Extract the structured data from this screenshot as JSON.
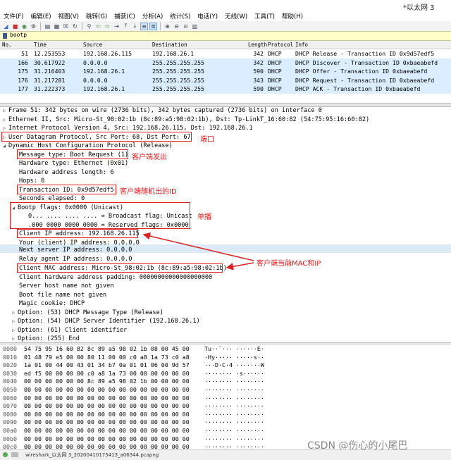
{
  "window": {
    "title": "*以太网 3"
  },
  "menu": [
    "文件(F)",
    "编辑(E)",
    "视图(V)",
    "跳转(G)",
    "捕获(C)",
    "分析(A)",
    "统计(S)",
    "电话(Y)",
    "无线(W)",
    "工具(T)",
    "帮助(H)"
  ],
  "toolbar_icons": [
    "shark-fin-start-icon",
    "stop-icon",
    "restart-icon",
    "options-gear-icon",
    "open-file-icon",
    "save-icon",
    "close-file-icon",
    "reload-icon",
    "find-icon",
    "back-arrow-icon",
    "forward-arrow-icon",
    "goto-packet-icon",
    "first-packet-icon",
    "last-packet-icon",
    "autoscroll-icon",
    "colorize-icon",
    "zoom-in-icon",
    "zoom-out-icon",
    "zoom-reset-icon",
    "resize-columns-icon"
  ],
  "filter": {
    "value": "bootp"
  },
  "packet_list": {
    "headers": {
      "no": "No.",
      "time": "Time",
      "source": "Source",
      "destination": "Destination",
      "length": "Length",
      "protocol": "Protocol",
      "info": "Info"
    },
    "rows": [
      {
        "no": "51",
        "time": "12.253553",
        "source": "192.168.26.115",
        "destination": "192.168.26.1",
        "length": "342",
        "protocol": "DHCP",
        "info": "DHCP Release  - Transaction ID 0x9d57edf5"
      },
      {
        "no": "166",
        "time": "30.617922",
        "source": "0.0.0.0",
        "destination": "255.255.255.255",
        "length": "342",
        "protocol": "DHCP",
        "info": "DHCP Discover - Transaction ID 0xbaeabefd"
      },
      {
        "no": "175",
        "time": "31.216403",
        "source": "192.168.26.1",
        "destination": "255.255.255.255",
        "length": "590",
        "protocol": "DHCP",
        "info": "DHCP Offer    - Transaction ID 0xbaeabefd"
      },
      {
        "no": "176",
        "time": "31.217281",
        "source": "0.0.0.0",
        "destination": "255.255.255.255",
        "length": "343",
        "protocol": "DHCP",
        "info": "DHCP Request  - Transaction ID 0xbaeabefd"
      },
      {
        "no": "177",
        "time": "31.222373",
        "source": "192.168.26.1",
        "destination": "255.255.255.255",
        "length": "590",
        "protocol": "DHCP",
        "info": "DHCP ACK      - Transaction ID 0xbaeabefd"
      }
    ]
  },
  "details": [
    {
      "text": "Frame 51: 342 bytes on wire (2736 bits), 342 bytes captured (2736 bits) on interface 0",
      "tri": "▷"
    },
    {
      "text": "Ethernet II, Src: Micro-St_98:02:1b (8c:89:a5:98:02:1b), Dst: Tp-LinkT_16:60:82 (54:75:95:16:60:82)",
      "tri": "▷"
    },
    {
      "text": "Internet Protocol Version 4, Src: 192.168.26.115, Dst: 192.168.26.1",
      "tri": "▷"
    },
    {
      "text": "User Datagram Protocol, Src Port: 68, Dst Port: 67",
      "tri": "▷"
    },
    {
      "text": "Dynamic Host Configuration Protocol (Release)",
      "tri": "◢"
    },
    {
      "text": "Message type: Boot Request (1)",
      "tri": ""
    },
    {
      "text": "Hardware type: Ethernet (0x01)",
      "tri": ""
    },
    {
      "text": "Hardware address length: 6",
      "tri": ""
    },
    {
      "text": "Hops: 0",
      "tri": ""
    },
    {
      "text": "Transaction ID: 0x9d57edf5",
      "tri": ""
    },
    {
      "text": "Seconds elapsed: 0",
      "tri": ""
    },
    {
      "text": "Bootp flags: 0x0000 (Unicast)",
      "tri": "◢"
    },
    {
      "text": "0... .... .... .... = Broadcast flag: Unicast",
      "tri": ""
    },
    {
      "text": ".000 0000 0000 0000 = Reserved flags: 0x0000",
      "tri": ""
    },
    {
      "text": "Client IP address: 192.168.26.115",
      "tri": ""
    },
    {
      "text": "Your (client) IP address: 0.0.0.0",
      "tri": ""
    },
    {
      "text": "Next server IP address: 0.0.0.0",
      "tri": ""
    },
    {
      "text": "Relay agent IP address: 0.0.0.0",
      "tri": ""
    },
    {
      "text": "Client MAC address: Micro-St_98:02:1b (8c:89:a5:98:02:1b)",
      "tri": ""
    },
    {
      "text": "Client hardware address padding: 00000000000000000000",
      "tri": ""
    },
    {
      "text": "Server host name not given",
      "tri": ""
    },
    {
      "text": "Boot file name not given",
      "tri": ""
    },
    {
      "text": "Magic cookie: DHCP",
      "tri": ""
    },
    {
      "text": "Option: (53) DHCP Message Type (Release)",
      "tri": "▷"
    },
    {
      "text": "Option: (54) DHCP Server Identifier (192.168.26.1)",
      "tri": "▷"
    },
    {
      "text": "Option: (61) Client identifier",
      "tri": "▷"
    },
    {
      "text": "Option: (255) End",
      "tri": "▷"
    }
  ],
  "annotations": {
    "port": "端口",
    "client_send": "客户端发出",
    "client_random_id": "客户端随机出的ID",
    "unicast": "单播",
    "client_mac_ip": "客户端当前MAC和IP"
  },
  "bytes": [
    {
      "off": "0000",
      "hex": "54 75 95 16 60 82 8c 89  a5 98 02 1b 08 00 45 00",
      "ascii": "Tu··`··· ······E·"
    },
    {
      "off": "0010",
      "hex": "01 48 79 e5 00 00 80 11  00 00 c0 a8 1a 73 c0 a8",
      "ascii": "·Hy····· ·····s··"
    },
    {
      "off": "0020",
      "hex": "1a 01 00 44 00 43 01 34  b7 0a 01 01 06 00 9d 57",
      "ascii": "···D·C·4 ·······W"
    },
    {
      "off": "0030",
      "hex": "ed f5 00 00 00 00 c0 a8  1a 73 00 00 00 00 00 00",
      "ascii": "········ ·s······"
    },
    {
      "off": "0040",
      "hex": "00 00 00 00 00 00 8c 89  a5 98 02 1b 00 00 00 00",
      "ascii": "········ ········"
    },
    {
      "off": "0050",
      "hex": "00 00 00 00 00 00 00 00  00 00 00 00 00 00 00 00",
      "ascii": "········ ········"
    },
    {
      "off": "0060",
      "hex": "00 00 00 00 00 00 00 00  00 00 00 00 00 00 00 00",
      "ascii": "········ ········"
    },
    {
      "off": "0070",
      "hex": "00 00 00 00 00 00 00 00  00 00 00 00 00 00 00 00",
      "ascii": "········ ········"
    },
    {
      "off": "0080",
      "hex": "00 00 00 00 00 00 00 00  00 00 00 00 00 00 00 00",
      "ascii": "········ ········"
    },
    {
      "off": "0090",
      "hex": "00 00 00 00 00 00 00 00  00 00 00 00 00 00 00 00",
      "ascii": "········ ········"
    },
    {
      "off": "00a0",
      "hex": "00 00 00 00 00 00 00 00  00 00 00 00 00 00 00 00",
      "ascii": "········ ········"
    },
    {
      "off": "00b0",
      "hex": "00 00 00 00 00 00 00 00  00 00 00 00 00 00 00 00",
      "ascii": "········ ········"
    },
    {
      "off": "00c0",
      "hex": "00 00 00 00 00 00 00 00  00 00 00 00 00 00 00 00",
      "ascii": "········ ········"
    }
  ],
  "status": {
    "file": "wireshark_以太网 3_20200410175413_a06344.pcapng"
  },
  "watermark": "CSDN @伤心的小尾巴",
  "colors": {
    "annotation_red": "#e02020",
    "filter_bg": "#fffec8",
    "selected_row": "#c6e4f7"
  }
}
